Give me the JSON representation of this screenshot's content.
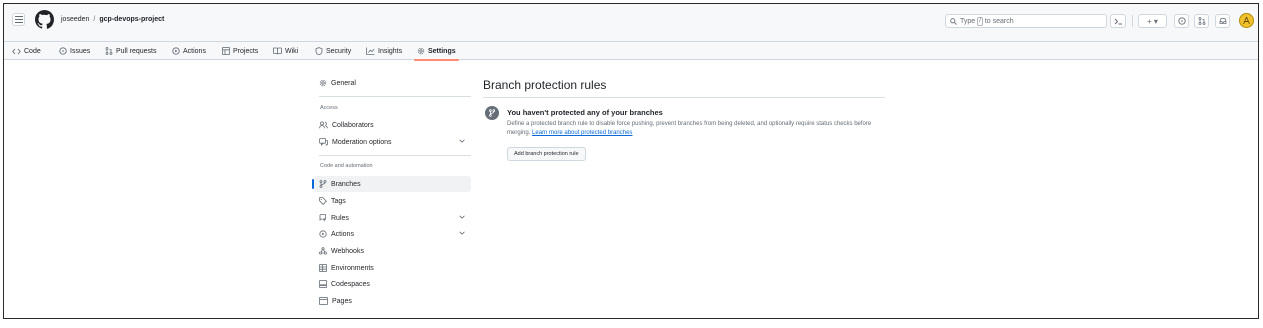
{
  "header": {
    "owner": "joseeden",
    "separator": "/",
    "repo": "gcp-devops-project",
    "search_before": "Type",
    "search_key": "/",
    "search_after": "to search",
    "plus_label": "+ ▾"
  },
  "tabs": [
    {
      "label": "Code",
      "icon": "code-icon"
    },
    {
      "label": "Issues",
      "icon": "issue-icon"
    },
    {
      "label": "Pull requests",
      "icon": "pull-request-icon"
    },
    {
      "label": "Actions",
      "icon": "play-icon"
    },
    {
      "label": "Projects",
      "icon": "table-icon"
    },
    {
      "label": "Wiki",
      "icon": "book-icon"
    },
    {
      "label": "Security",
      "icon": "shield-icon"
    },
    {
      "label": "Insights",
      "icon": "graph-icon"
    },
    {
      "label": "Settings",
      "icon": "gear-icon",
      "active": true
    }
  ],
  "sidebar": {
    "general": "General",
    "access_heading": "Access",
    "collaborators": "Collaborators",
    "moderation": "Moderation options",
    "code_heading": "Code and automation",
    "branches": "Branches",
    "tags": "Tags",
    "rules": "Rules",
    "actions": "Actions",
    "webhooks": "Webhooks",
    "environments": "Environments",
    "codespaces": "Codespaces",
    "pages": "Pages"
  },
  "main": {
    "title": "Branch protection rules",
    "empty_heading": "You haven't protected any of your branches",
    "empty_desc": "Define a protected branch rule to disable force pushing, prevent branches from being deleted, and optionally require status checks before merging.",
    "learn_more": "Learn more about protected branches",
    "add_button": "Add branch protection rule"
  },
  "colors": {
    "accent": "#0969da",
    "tab_underline": "#fd8c73",
    "avatar": "#f2c12e"
  }
}
